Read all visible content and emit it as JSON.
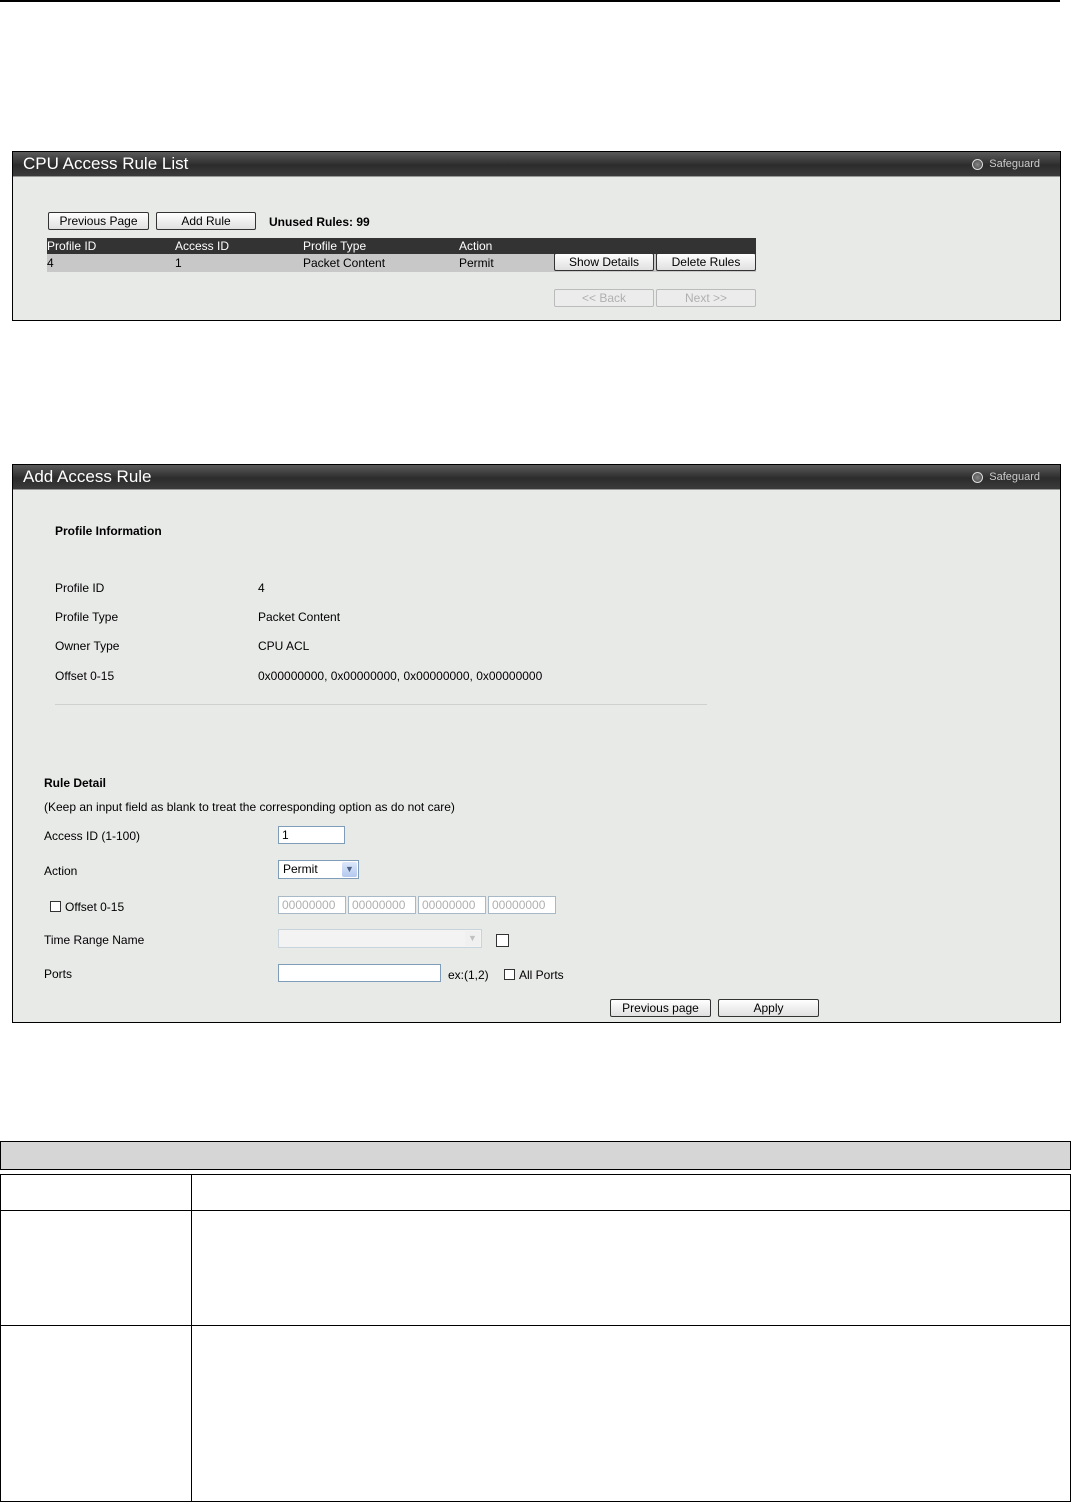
{
  "rule_list": {
    "title": "CPU Access Rule List",
    "safeguard": "Safeguard",
    "prev_page_label": "Previous Page",
    "add_rule_label": "Add Rule",
    "unused_rules": "Unused Rules: 99",
    "columns": [
      "Profile ID",
      "Access ID",
      "Profile Type",
      "Action"
    ],
    "rows": [
      {
        "profile_id": "4",
        "access_id": "1",
        "profile_type": "Packet Content",
        "action": "Permit"
      }
    ],
    "show_details_label": "Show Details",
    "delete_rules_label": "Delete Rules",
    "back_label": "<< Back",
    "next_label": "Next >>"
  },
  "add_rule": {
    "title": "Add Access Rule",
    "safeguard": "Safeguard",
    "profile_info_heading": "Profile Information",
    "profile_fields": [
      {
        "label": "Profile ID",
        "value": "4"
      },
      {
        "label": "Profile Type",
        "value": "Packet Content"
      },
      {
        "label": "Owner Type",
        "value": "CPU ACL"
      },
      {
        "label": "Offset 0-15",
        "value": "0x00000000, 0x00000000, 0x00000000, 0x00000000"
      }
    ],
    "rule_detail_heading": "Rule Detail",
    "rule_detail_note": "(Keep an input field as blank to treat the corresponding option as do not care)",
    "access_id_label": "Access ID (1-100)",
    "access_id_value": "1",
    "action_label": "Action",
    "action_value": "Permit",
    "offset_label": "Offset 0-15",
    "offset_values": [
      "00000000",
      "00000000",
      "00000000",
      "00000000"
    ],
    "time_range_label": "Time Range Name",
    "ports_label": "Ports",
    "ports_value": "",
    "ports_example": "ex:(1,2)",
    "all_ports_label": "All Ports",
    "prev_page_label": "Previous page",
    "apply_label": "Apply"
  }
}
